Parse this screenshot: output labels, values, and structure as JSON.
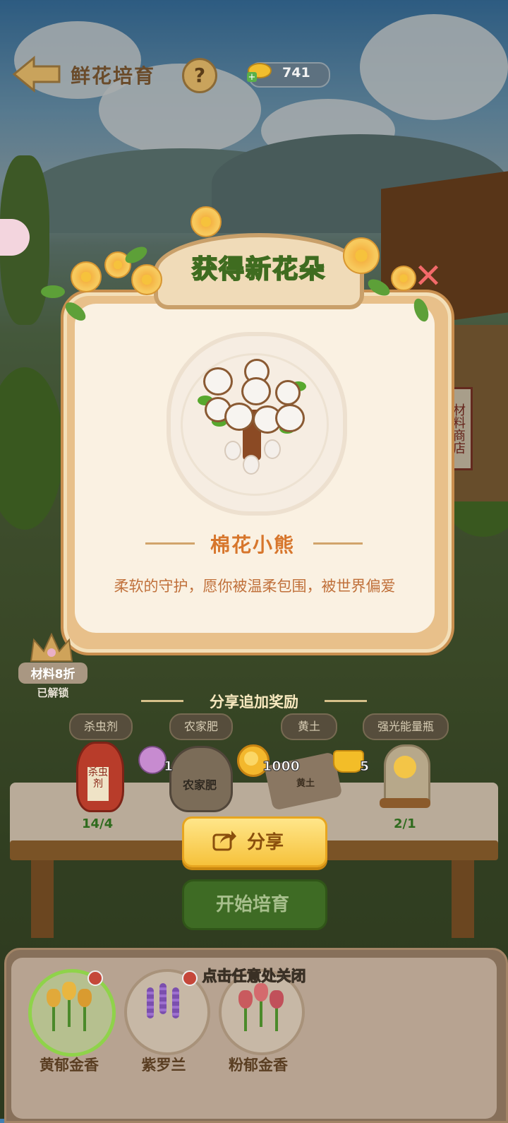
{
  "header": {
    "title": "鲜花培育",
    "help": "?",
    "currency_value": "741"
  },
  "shop": {
    "sign": "材料商店"
  },
  "modal": {
    "title": "获得新花朵",
    "flower_name": "棉花小熊",
    "flower_desc": "柔软的守护，愿你被温柔包围，被世界偏爱"
  },
  "discount": {
    "label": "材料8折",
    "status": "已解锁"
  },
  "share_bonus": {
    "title": "分享追加奖励",
    "materials": [
      "杀虫剂",
      "农家肥",
      "黄土",
      "强光能量瓶"
    ],
    "rewards": {
      "gem": "1",
      "coins": "1000",
      "ingots": "5"
    }
  },
  "items": {
    "pesticide_label": "杀虫剂",
    "fertilizer_label": "农家肥",
    "soil_label": "黄土",
    "pesticide_count": "14/4",
    "light_count": "2/1"
  },
  "buttons": {
    "share": "分享",
    "start": "开始培育"
  },
  "bottom": {
    "close_hint": "点击任意处关闭",
    "flowers": [
      "黄郁金香",
      "紫罗兰",
      "粉郁金香"
    ]
  },
  "colors": {
    "title_green": "#3f6c20",
    "name_orange": "#d7762c",
    "share_yellow": "#f6c23b",
    "start_green": "#3e6b24"
  }
}
